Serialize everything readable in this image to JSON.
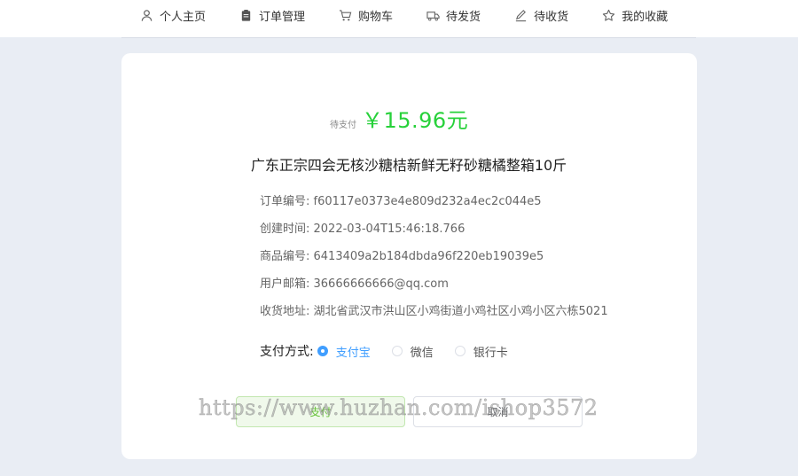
{
  "nav": {
    "items": [
      {
        "label": "个人主页",
        "icon": "user-icon"
      },
      {
        "label": "订单管理",
        "icon": "clipboard-icon"
      },
      {
        "label": "购物车",
        "icon": "cart-icon"
      },
      {
        "label": "待发货",
        "icon": "truck-icon"
      },
      {
        "label": "待收货",
        "icon": "pen-icon"
      },
      {
        "label": "我的收藏",
        "icon": "star-icon"
      }
    ]
  },
  "order": {
    "status_label": "待支付",
    "price": "￥15.96元",
    "product_title": "广东正宗四会无核沙糖桔新鲜无籽砂糖橘整箱10斤",
    "info": [
      "订单编号: f60117e0373e4e809d232a4ec2c044e5",
      "创建时间: 2022-03-04T15:46:18.766",
      "商品编号: 6413409a2b184dbda96f220eb19039e5",
      "用户邮箱: 36666666666@qq.com",
      "收货地址: 湖北省武汉市洪山区小鸡街道小鸡社区小鸡小区六栋5021"
    ]
  },
  "payment": {
    "label": "支付方式:",
    "options": [
      {
        "label": "支付宝",
        "checked": true
      },
      {
        "label": "微信",
        "checked": false
      },
      {
        "label": "银行卡",
        "checked": false
      }
    ]
  },
  "buttons": {
    "pay_label": "支付",
    "cancel_label": "取消"
  },
  "watermark": "https://www.huzhan.com/ishop3572",
  "colors": {
    "background": "#e9edf4",
    "price_green": "#27d13a",
    "radio_blue": "#409eff"
  }
}
